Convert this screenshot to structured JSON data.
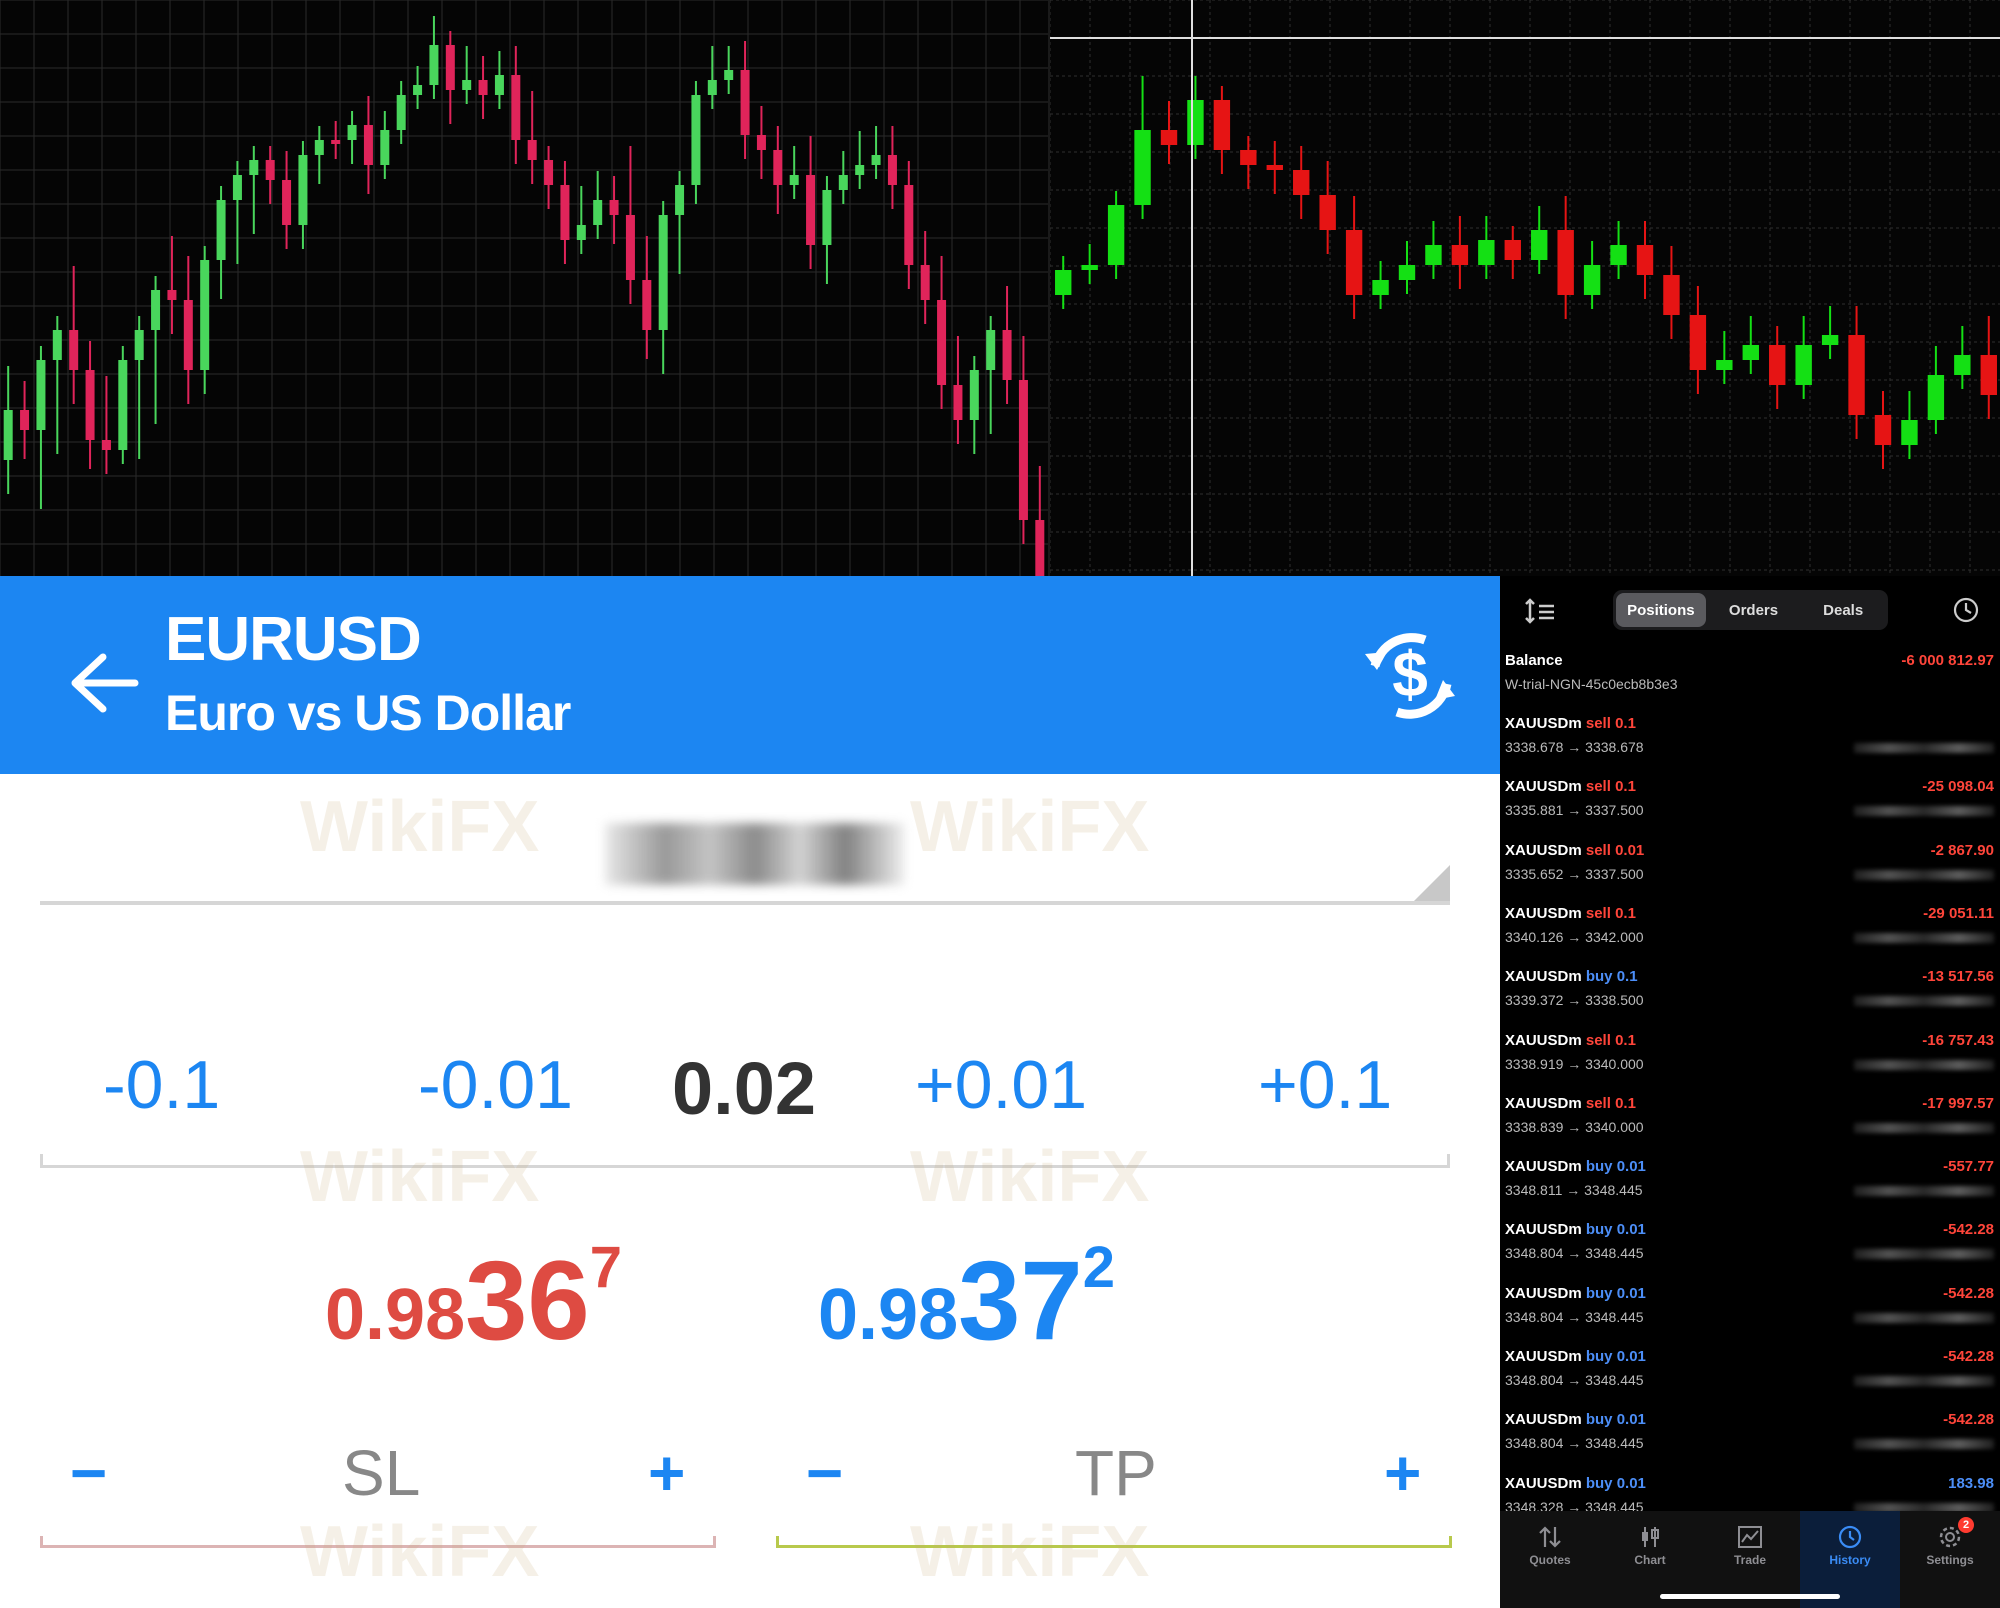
{
  "charts": {
    "left": {
      "candles": [
        [
          460,
          410,
          480,
          380
        ],
        [
          410,
          430,
          445,
          395
        ],
        [
          430,
          360,
          375,
          495
        ],
        [
          360,
          330,
          350,
          440
        ],
        [
          330,
          370,
          390,
          280
        ],
        [
          370,
          440,
          455,
          355
        ],
        [
          440,
          450,
          460,
          390
        ],
        [
          450,
          360,
          380,
          445
        ],
        [
          360,
          330,
          350,
          445
        ],
        [
          330,
          290,
          300,
          410
        ],
        [
          290,
          300,
          320,
          250
        ],
        [
          300,
          370,
          390,
          270
        ],
        [
          370,
          260,
          275,
          380
        ],
        [
          260,
          200,
          215,
          285
        ],
        [
          200,
          175,
          190,
          250
        ],
        [
          175,
          160,
          170,
          220
        ],
        [
          160,
          180,
          190,
          180
        ],
        [
          180,
          225,
          235,
          165
        ],
        [
          225,
          155,
          170,
          235
        ],
        [
          155,
          140,
          150,
          170
        ],
        [
          140,
          140,
          145,
          135
        ],
        [
          140,
          125,
          130,
          150
        ],
        [
          125,
          165,
          180,
          110
        ],
        [
          165,
          130,
          140,
          125
        ],
        [
          130,
          95,
          105,
          100
        ],
        [
          95,
          85,
          95,
          80
        ],
        [
          85,
          45,
          55,
          30
        ],
        [
          45,
          90,
          100,
          110
        ],
        [
          90,
          80,
          85,
          60
        ],
        [
          80,
          95,
          105,
          70
        ],
        [
          95,
          75,
          85,
          65
        ],
        [
          75,
          140,
          150,
          60
        ],
        [
          140,
          160,
          170,
          105
        ],
        [
          160,
          185,
          195,
          160
        ],
        [
          185,
          240,
          250,
          175
        ],
        [
          240,
          225,
          240,
          200
        ],
        [
          225,
          200,
          210,
          185
        ],
        [
          200,
          215,
          230,
          190
        ],
        [
          215,
          280,
          290,
          160
        ],
        [
          280,
          330,
          345,
          250
        ],
        [
          330,
          215,
          225,
          360
        ],
        [
          215,
          185,
          195,
          260
        ],
        [
          185,
          95,
          110,
          190
        ],
        [
          95,
          80,
          85,
          60
        ],
        [
          80,
          70,
          75,
          60
        ],
        [
          70,
          135,
          145,
          55
        ],
        [
          135,
          150,
          165,
          120
        ],
        [
          150,
          185,
          200,
          140
        ],
        [
          185,
          175,
          185,
          160
        ],
        [
          175,
          245,
          255,
          150
        ],
        [
          245,
          190,
          205,
          270
        ],
        [
          190,
          175,
          185,
          165
        ],
        [
          175,
          165,
          175,
          145
        ],
        [
          165,
          155,
          160,
          140
        ],
        [
          155,
          185,
          195,
          140
        ],
        [
          185,
          265,
          275,
          175
        ],
        [
          265,
          300,
          310,
          245
        ],
        [
          300,
          385,
          395,
          270
        ],
        [
          385,
          420,
          430,
          350
        ],
        [
          420,
          370,
          380,
          440
        ],
        [
          370,
          330,
          345,
          420
        ],
        [
          330,
          380,
          390,
          300
        ],
        [
          380,
          520,
          530,
          350
        ],
        [
          520,
          580,
          590,
          480
        ]
      ],
      "up_color": "#49d65c",
      "down_color": "#e0245a"
    },
    "right": {
      "candles": [
        [
          295,
          270,
          280,
          290
        ],
        [
          270,
          265,
          268,
          258
        ],
        [
          265,
          205,
          215,
          230
        ],
        [
          205,
          130,
          140,
          90
        ],
        [
          130,
          145,
          150,
          115
        ],
        [
          145,
          100,
          110,
          90
        ],
        [
          100,
          150,
          160,
          130
        ],
        [
          150,
          165,
          175,
          150
        ],
        [
          165,
          170,
          180,
          155
        ],
        [
          170,
          195,
          205,
          160
        ],
        [
          195,
          230,
          240,
          175
        ],
        [
          230,
          295,
          305,
          210
        ],
        [
          295,
          280,
          290,
          275
        ],
        [
          280,
          265,
          275,
          255
        ],
        [
          265,
          245,
          255,
          235
        ],
        [
          245,
          265,
          275,
          230
        ],
        [
          265,
          240,
          250,
          230
        ],
        [
          240,
          260,
          265,
          245
        ],
        [
          260,
          230,
          240,
          220
        ],
        [
          230,
          295,
          305,
          210
        ],
        [
          295,
          265,
          275,
          255
        ],
        [
          265,
          245,
          255,
          235
        ],
        [
          245,
          275,
          285,
          235
        ],
        [
          275,
          315,
          325,
          260
        ],
        [
          315,
          370,
          380,
          300
        ],
        [
          370,
          360,
          370,
          345
        ],
        [
          360,
          345,
          355,
          330
        ],
        [
          345,
          385,
          395,
          340
        ],
        [
          385,
          345,
          355,
          330
        ],
        [
          345,
          335,
          345,
          320
        ],
        [
          335,
          415,
          425,
          320
        ],
        [
          415,
          445,
          455,
          405
        ],
        [
          445,
          420,
          430,
          405
        ],
        [
          420,
          375,
          385,
          360
        ],
        [
          375,
          355,
          365,
          340
        ],
        [
          355,
          395,
          405,
          330
        ]
      ],
      "up_color": "#14e014",
      "down_color": "#e61414"
    }
  },
  "order": {
    "symbol": "EURUSD",
    "description": "Euro vs US Dollar",
    "steps": [
      "-0.1",
      "-0.01",
      "+0.01",
      "+0.1"
    ],
    "volume": "0.02",
    "bid": {
      "main": "0.98",
      "big": "36",
      "sup": "7"
    },
    "ask": {
      "main": "0.98",
      "big": "37",
      "sup": "2"
    },
    "sl_label": "SL",
    "tp_label": "TP",
    "minus": "−",
    "plus": "+",
    "accent_color": "#1c86f2",
    "sell_color": "#de4b42"
  },
  "history": {
    "segments": [
      "Positions",
      "Orders",
      "Deals"
    ],
    "active_segment": "Positions",
    "balance": {
      "label": "Balance",
      "amount": "-6 000 812.97",
      "account": "W-trial-NGN-45c0ecb8b3e3"
    },
    "rows": [
      {
        "symbol": "XAUUSDm",
        "side": "sell",
        "volume": "0.1",
        "prices": "3338.678 → 3338.678",
        "amount": ""
      },
      {
        "symbol": "XAUUSDm",
        "side": "sell",
        "volume": "0.1",
        "prices": "3335.881 → 3337.500",
        "amount": "-25 098.04"
      },
      {
        "symbol": "XAUUSDm",
        "side": "sell",
        "volume": "0.01",
        "prices": "3335.652 → 3337.500",
        "amount": "-2 867.90"
      },
      {
        "symbol": "XAUUSDm",
        "side": "sell",
        "volume": "0.1",
        "prices": "3340.126 → 3342.000",
        "amount": "-29 051.11"
      },
      {
        "symbol": "XAUUSDm",
        "side": "buy",
        "volume": "0.1",
        "prices": "3339.372 → 3338.500",
        "amount": "-13 517.56"
      },
      {
        "symbol": "XAUUSDm",
        "side": "sell",
        "volume": "0.1",
        "prices": "3338.919 → 3340.000",
        "amount": "-16 757.43"
      },
      {
        "symbol": "XAUUSDm",
        "side": "sell",
        "volume": "0.1",
        "prices": "3338.839 → 3340.000",
        "amount": "-17 997.57"
      },
      {
        "symbol": "XAUUSDm",
        "side": "buy",
        "volume": "0.01",
        "prices": "3348.811 → 3348.445",
        "amount": "-557.77"
      },
      {
        "symbol": "XAUUSDm",
        "side": "buy",
        "volume": "0.01",
        "prices": "3348.804 → 3348.445",
        "amount": "-542.28"
      },
      {
        "symbol": "XAUUSDm",
        "side": "buy",
        "volume": "0.01",
        "prices": "3348.804 → 3348.445",
        "amount": "-542.28"
      },
      {
        "symbol": "XAUUSDm",
        "side": "buy",
        "volume": "0.01",
        "prices": "3348.804 → 3348.445",
        "amount": "-542.28"
      },
      {
        "symbol": "XAUUSDm",
        "side": "buy",
        "volume": "0.01",
        "prices": "3348.804 → 3348.445",
        "amount": "-542.28"
      },
      {
        "symbol": "XAUUSDm",
        "side": "buy",
        "volume": "0.01",
        "prices": "3348.328 → 3348.445",
        "amount": "183.98"
      }
    ],
    "tabs": [
      {
        "label": "Quotes",
        "icon": "arrows-updown-icon"
      },
      {
        "label": "Chart",
        "icon": "candles-icon"
      },
      {
        "label": "Trade",
        "icon": "trade-chart-icon"
      },
      {
        "label": "History",
        "icon": "history-clock-icon"
      },
      {
        "label": "Settings",
        "icon": "gear-icon"
      }
    ],
    "active_tab": "History",
    "settings_badge": "2"
  },
  "watermark": "WikiFX"
}
